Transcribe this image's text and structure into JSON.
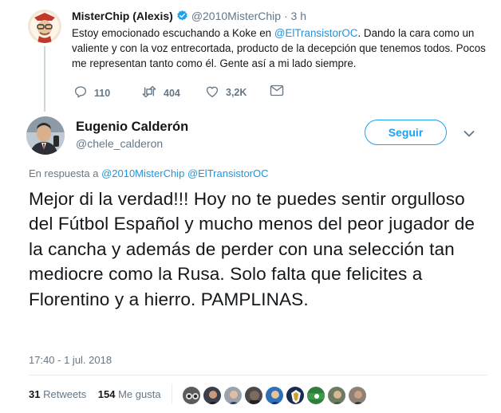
{
  "parent_tweet": {
    "author_name": "MisterChip (Alexis)",
    "author_handle": "@2010MisterChip",
    "separator": "·",
    "time_ago": "3 h",
    "text_1": "Estoy emocionado escuchando a Koke en ",
    "mention": "@ElTransistorOC",
    "text_2": ". Dando la cara como un valiente y con la voz entrecortada, producto de la decepción que tenemos todos. Pocos me representan tanto como él. Gente así a mi lado siempre.",
    "actions": {
      "replies": "110",
      "retweets": "404",
      "likes": "3,2K"
    }
  },
  "tweet": {
    "author_name": "Eugenio Calderón",
    "author_handle": "@chele_calderon",
    "follow_label": "Seguir",
    "reply_prefix": "En respuesta a ",
    "reply_mention_1": "@2010MisterChip",
    "reply_mention_2": "@ElTransistorOC",
    "text": "Mejor di la verdad!!! Hoy no te puedes sentir orgulloso del Fútbol Español y mucho menos del peor jugador de la cancha y además de perder con una selección tan mediocre como la Rusa. Solo falta que felicites a Florentino y a hierro. PAMPLINAS.",
    "timestamp": "17:40 - 1 jul. 2018",
    "stats": {
      "retweets_count": "31",
      "retweets_label": "Retweets",
      "likes_count": "154",
      "likes_label": "Me gusta"
    },
    "likers": [
      "avatar-1",
      "avatar-2",
      "avatar-3",
      "avatar-4",
      "avatar-5",
      "avatar-6",
      "avatar-7",
      "avatar-8",
      "avatar-9"
    ]
  },
  "colors": {
    "brand_blue": "#1da1f2",
    "link_blue": "#1b95e0",
    "text_dark": "#14171a",
    "text_muted": "#657786",
    "divider": "#e6ecf0"
  }
}
